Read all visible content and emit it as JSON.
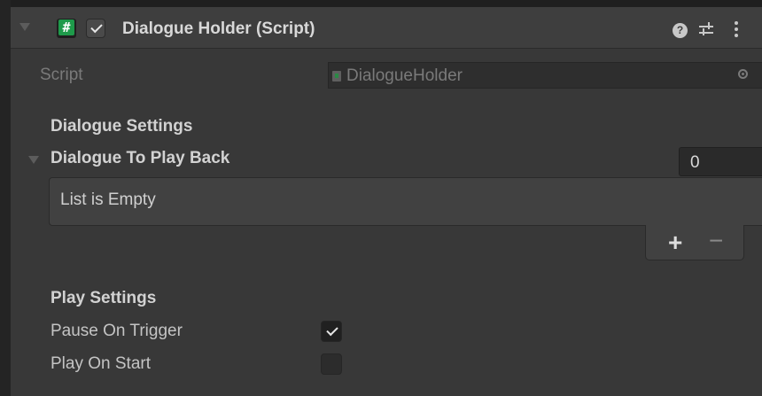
{
  "component": {
    "title": "Dialogue Holder (Script)",
    "help_glyph": "?",
    "enabled": true
  },
  "script_row": {
    "label": "Script",
    "value": "DialogueHolder"
  },
  "dialogue_settings": {
    "header": "Dialogue Settings",
    "list": {
      "label": "Dialogue To Play Back",
      "size": "0",
      "empty_text": "List is Empty",
      "add_label": "+",
      "remove_label": "−"
    }
  },
  "play_settings": {
    "header": "Play Settings",
    "pause_on_trigger": {
      "label": "Pause On Trigger",
      "checked": true
    },
    "play_on_start": {
      "label": "Play On Start",
      "checked": false
    }
  },
  "colors": {
    "panel": "#383838",
    "header": "#3e3e3e",
    "script_icon": "#1e9a4a"
  },
  "icons": [
    "fold-arrow-icon",
    "script-hash-icon",
    "help-icon",
    "preset-sliders-icon",
    "kebab-menu-icon",
    "object-picker-icon"
  ]
}
